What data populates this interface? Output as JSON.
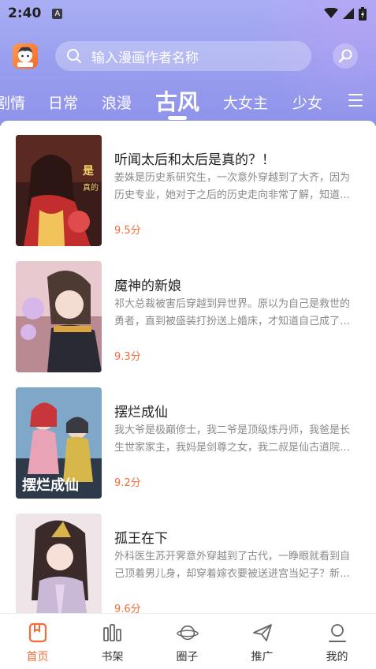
{
  "status_bar": {
    "time": "2:40",
    "notification_letter": "A"
  },
  "search": {
    "placeholder": "输入漫画作者名称"
  },
  "tabs": [
    {
      "label": "剧情"
    },
    {
      "label": "日常"
    },
    {
      "label": "浪漫"
    },
    {
      "label": "古风",
      "active": true
    },
    {
      "label": "大女主"
    },
    {
      "label": "少女"
    }
  ],
  "comics": [
    {
      "title": "听闻太后和太后是真的？！",
      "description": "姜姝是历史系研究生，一次意外穿越到了大齐，因为历史专业，她对于之后的历史走向非常了解，知道…",
      "score": "9.5分"
    },
    {
      "title": "魔神的新娘",
      "description": "祁大总裁被害后穿越到异世界。原以为自己是救世的勇者，直到被盛装打扮送上婚床，才知道自己成了…",
      "score": "9.3分"
    },
    {
      "title": "摆烂成仙",
      "description": "我大爷是极巅修士，我二爷是顶级炼丹师，我爸是长生世家家主，我妈是剑尊之女，我二叔是仙古道院…",
      "score": "9.2分"
    },
    {
      "title": "孤王在下",
      "description": "外科医生苏开霁意外穿越到了古代，一睁眼就看到自己顶着男儿身，却穿着嫁衣要被送进宫当妃子？新…",
      "score": "9.6分"
    }
  ],
  "bottom_nav": [
    {
      "label": "首页",
      "icon": "home-book-icon",
      "active": true
    },
    {
      "label": "书架",
      "icon": "bookshelf-icon"
    },
    {
      "label": "圈子",
      "icon": "planet-icon"
    },
    {
      "label": "推广",
      "icon": "paper-plane-icon"
    },
    {
      "label": "我的",
      "icon": "profile-icon"
    }
  ],
  "colors": {
    "accent": "#f26b3a",
    "header": "#9aa0ef"
  }
}
